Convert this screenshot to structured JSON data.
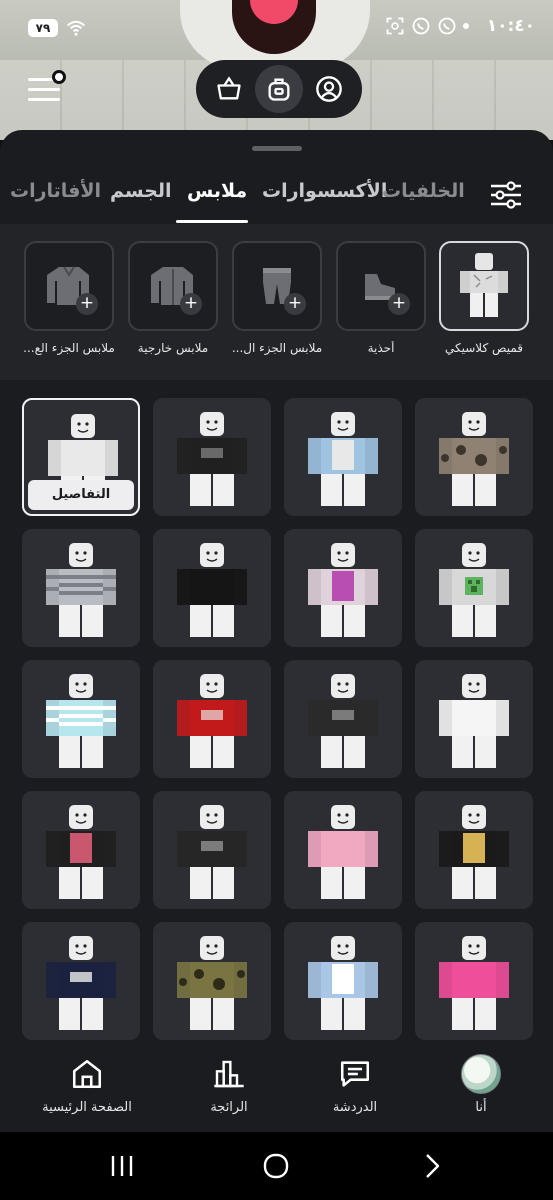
{
  "status_bar": {
    "time": "١٠:٤٠",
    "battery": "٧٩"
  },
  "header": {
    "menu_icon": "hamburger-icon",
    "pill_buttons": [
      {
        "icon": "shopping-basket-icon"
      },
      {
        "icon": "backpack-icon",
        "active": true
      },
      {
        "icon": "profile-circle-icon"
      }
    ]
  },
  "tabs": [
    {
      "label": "الخلفيات"
    },
    {
      "label": "الأكسسوارات"
    },
    {
      "label": "ملابس",
      "active": true
    },
    {
      "label": "الجسم"
    },
    {
      "label": "الأفاتارات"
    }
  ],
  "categories": [
    {
      "label": "قميص كلاسيكي",
      "selected": true,
      "icon": "classic-shirt-icon"
    },
    {
      "label": "أحذية",
      "icon": "shoe-icon"
    },
    {
      "label": "...ملابس الجزء ال",
      "icon": "pants-icon"
    },
    {
      "label": "ملابس خارجية",
      "icon": "jacket-icon"
    },
    {
      "label": "...ملابس الجزء الع",
      "icon": "shirt-icon"
    }
  ],
  "details_label": "التفاصيل",
  "items": [
    {
      "shirt": "#8f8272",
      "accent": "#3d352c",
      "style": "camo"
    },
    {
      "shirt": "#9ec4e2",
      "accent": "#e8e8e8",
      "style": "vest"
    },
    {
      "shirt": "#202020",
      "accent": "#777777",
      "style": "print"
    },
    {
      "shirt": "#e9e9e9",
      "accent": "#bdbdbd",
      "style": "plain",
      "selected": true
    },
    {
      "shirt": "#d8d8d8",
      "accent": "#5fb35f",
      "style": "creeper"
    },
    {
      "shirt": "#e0d2da",
      "accent": "#b84fb0",
      "style": "vest"
    },
    {
      "shirt": "#151515",
      "accent": "#ffffff",
      "style": "plain"
    },
    {
      "shirt": "#b9bcc2",
      "accent": "#7c7f86",
      "style": "stripes"
    },
    {
      "shirt": "#f5f5f5",
      "accent": "#e2e2e2",
      "style": "plain"
    },
    {
      "shirt": "#2a2a2a",
      "accent": "#8a8a8a",
      "style": "print"
    },
    {
      "shirt": "#c21a1a",
      "accent": "#e5c0c0",
      "style": "print"
    },
    {
      "shirt": "#b6e6ee",
      "accent": "#ffffff",
      "style": "stripes"
    },
    {
      "shirt": "#1a1a1a",
      "accent": "#d6b255",
      "style": "vest"
    },
    {
      "shirt": "#f1a9c2",
      "accent": "#e58eae",
      "style": "plain"
    },
    {
      "shirt": "#262626",
      "accent": "#8c8c8c",
      "style": "print"
    },
    {
      "shirt": "#1f1f1f",
      "accent": "#c9586f",
      "style": "vest"
    },
    {
      "shirt": "#ef4f9a",
      "accent": "#ffffff",
      "style": "plain"
    },
    {
      "shirt": "#a9c6e6",
      "accent": "#ffffff",
      "style": "vest"
    },
    {
      "shirt": "#7a7342",
      "accent": "#2d2b18",
      "style": "camo"
    },
    {
      "shirt": "#1a2240",
      "accent": "#e0e0e0",
      "style": "print"
    }
  ],
  "bottom_nav": [
    {
      "label": "أنا",
      "icon": "avatar"
    },
    {
      "label": "الدردشة",
      "icon": "chat-icon"
    },
    {
      "label": "الرائجة",
      "icon": "trending-chart-icon"
    },
    {
      "label": "الصفحة الرئيسية",
      "icon": "home-icon"
    }
  ],
  "system_nav": [
    "recent-apps-icon",
    "home-circle-icon",
    "back-icon"
  ]
}
